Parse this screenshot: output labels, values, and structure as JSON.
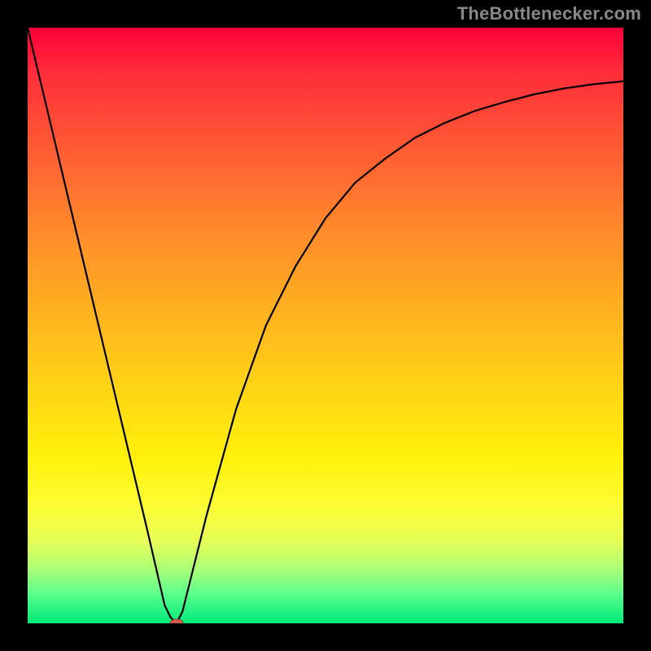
{
  "watermark": "TheBottlenecker.com",
  "chart_data": {
    "type": "line",
    "title": "",
    "xlabel": "",
    "ylabel": "",
    "xlim": [
      0,
      100
    ],
    "ylim": [
      0,
      100
    ],
    "series": [
      {
        "name": "bottleneck-curve",
        "x": [
          0,
          5,
          10,
          15,
          20,
          23,
          24,
          25,
          26,
          27,
          30,
          35,
          40,
          45,
          50,
          55,
          60,
          65,
          70,
          75,
          80,
          85,
          90,
          95,
          100
        ],
        "values": [
          100,
          79,
          58,
          37,
          16,
          3,
          1,
          0,
          2,
          6,
          18,
          36,
          50,
          60,
          68,
          74,
          78,
          81.5,
          84,
          86,
          87.5,
          88.8,
          89.8,
          90.5,
          91
        ]
      }
    ],
    "marker_point": {
      "x": 25,
      "y": 0
    },
    "colors": {
      "gradient_top": "#ff0038",
      "gradient_bottom": "#00e97a",
      "curve": "#000000",
      "marker": "#d45a4a",
      "frame": "#000000",
      "watermark": "#888888"
    }
  }
}
